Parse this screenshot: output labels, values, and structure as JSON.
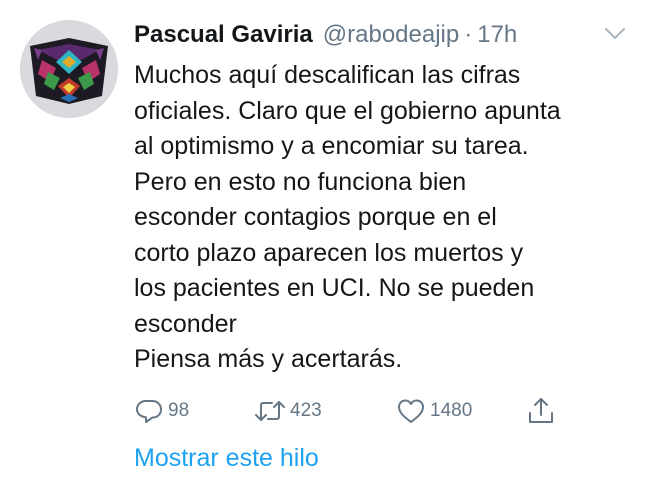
{
  "tweet": {
    "display_name": "Pascual Gaviria",
    "handle": "@rabodeajip",
    "separator": "·",
    "time": "17h",
    "avatar_icon": "patterned-avatar",
    "menu_icon": "chevron-down-icon",
    "text_lines": [
      "Muchos aquí descalifican las cifras",
      "oficiales. Claro que el gobierno apunta",
      "al optimismo y a encomiar su tarea.",
      "Pero en esto no funciona bien",
      "esconder contagios porque en el",
      "corto plazo aparecen los muertos y",
      "los pacientes en UCI. No se pueden",
      "esconder",
      "Piensa más y acertarás."
    ],
    "actions": {
      "reply_count": "98",
      "retweet_count": "423",
      "like_count": "1480"
    },
    "show_thread": "Mostrar este hilo"
  },
  "colors": {
    "text": "#14171a",
    "secondary": "#657786",
    "link": "#1da1f2"
  }
}
